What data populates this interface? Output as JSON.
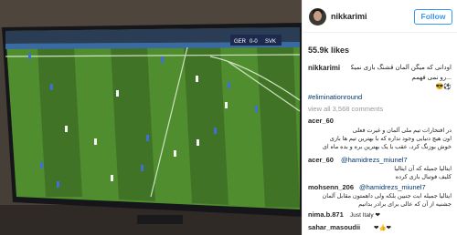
{
  "post": {
    "username": "nikkarimi",
    "follow_label": "Follow",
    "likes": "55.9k likes"
  },
  "caption": {
    "username": "nikkarimi",
    "line1": "اودانی که میگن آلمان قشنگ بازی نمیکنه",
    "line2": "...رو نمی فهمم",
    "line3": "⚽😎",
    "hashtag": "#eliminationround"
  },
  "view_all_comments": "view all 3,568 comments",
  "comments": [
    {
      "username": "acer_60",
      "lines": [
        "در افتخارات تیم ملی آلمان و غیرت فعلی",
        "اون هیچ دنیایی وجود نداره که با بهترین تیم ها بازی ",
        "خوش بوزنگ کرد، عقب با یک بهترین بره و بده ماه ای "
      ]
    },
    {
      "username": "acer_60",
      "mention": "@hamidrezs_miunel7",
      "lines": [
        "ایتالیا جمیله که آن ایتالیا",
        "کلیف فوتبال بازی کرده"
      ]
    },
    {
      "username": "mohsenn_206",
      "mention": "@hamidrezs_miunel7",
      "lines": [
        "ایتالیا جمیله ابت جنبین بلکه ولی داهمتون مقابل آلمان",
        "جشنیه از آن که عالی برای برادر بدانیم"
      ]
    },
    {
      "username": "nima.b.871",
      "text": "Just Italy ❤"
    },
    {
      "username": "sahar_masoudii",
      "text": "❤👍❤"
    }
  ],
  "tv": {
    "scoreboard_home": "GER",
    "scoreboard_score": "0-0",
    "scoreboard_away": "SVK"
  }
}
